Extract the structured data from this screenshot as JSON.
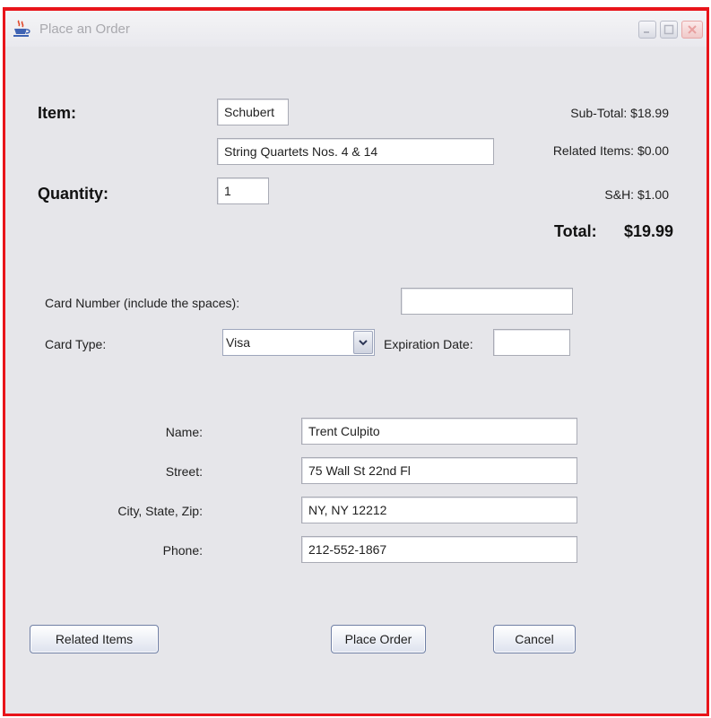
{
  "window": {
    "title": "Place an Order",
    "icons": [
      "java-cup-icon",
      "minimize-icon",
      "maximize-icon",
      "close-icon"
    ]
  },
  "item": {
    "label": "Item:",
    "composer": "Schubert",
    "title": "String Quartets Nos. 4 & 14"
  },
  "quantity": {
    "label": "Quantity:",
    "value": "1"
  },
  "summary": {
    "subtotal": "Sub-Total: $18.99",
    "related": "Related Items: $0.00",
    "shipping": "S&H: $1.00",
    "total_label": "Total:",
    "total_value": "$19.99"
  },
  "payment": {
    "card_number_label": "Card Number (include the spaces):",
    "card_number_value": "",
    "card_type_label": "Card Type:",
    "card_type_value": "Visa",
    "expiration_label": "Expiration Date:",
    "expiration_value": ""
  },
  "customer": {
    "name_label": "Name:",
    "name_value": "Trent Culpito",
    "street_label": "Street:",
    "street_value": "75 Wall St 22nd Fl",
    "city_label": "City, State, Zip:",
    "city_value": "NY, NY 12212",
    "phone_label": "Phone:",
    "phone_value": "212-552-1867"
  },
  "buttons": {
    "related": "Related Items",
    "place_order": "Place Order",
    "cancel": "Cancel"
  },
  "colors": {
    "frame_border": "#e8141a",
    "panel_background": "#e6e6ea",
    "title_text": "#a9a9ae"
  }
}
